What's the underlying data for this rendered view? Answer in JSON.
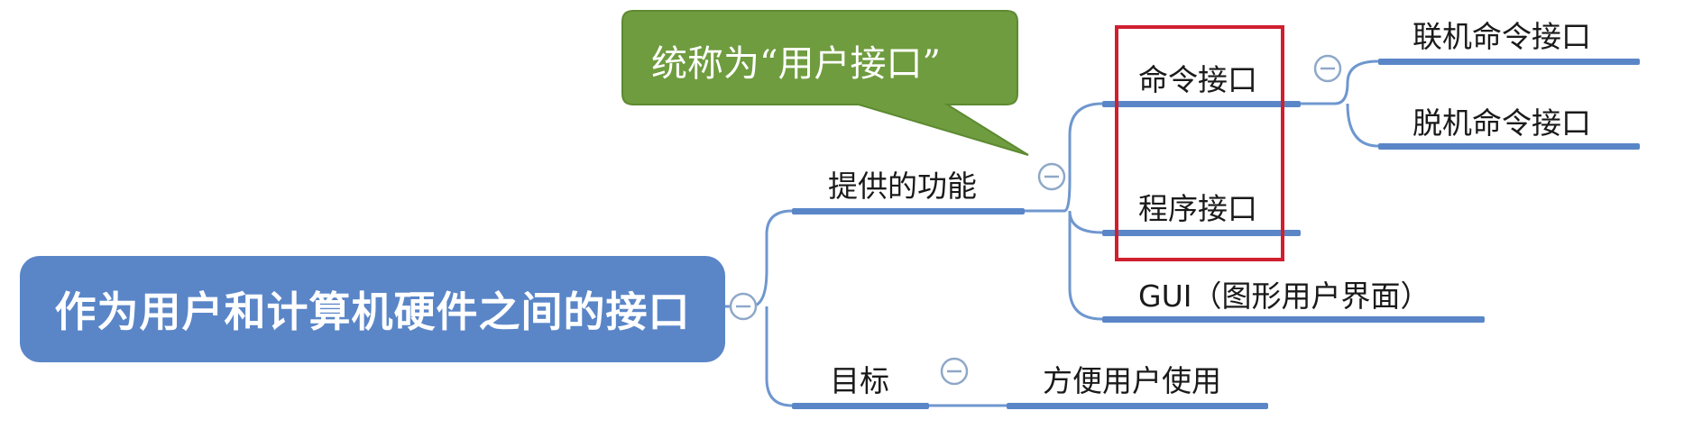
{
  "colors": {
    "root_fill": "#5a86c8",
    "branch_line": "#6f97cf",
    "underline": "#5a86c8",
    "callout_fill": "#6f9c3f",
    "highlight_border": "#d01f2f"
  },
  "root": {
    "label": "作为用户和计算机硬件之间的接口"
  },
  "callout": {
    "label": "统称为“用户接口”"
  },
  "branches": {
    "provide": {
      "label": "提供的功能"
    },
    "goal": {
      "label": "目标"
    }
  },
  "interfaces": {
    "command": {
      "label": "命令接口"
    },
    "program": {
      "label": "程序接口"
    },
    "gui": {
      "label": "GUI（图形用户界面）"
    }
  },
  "command_types": {
    "online": {
      "label": "联机命令接口"
    },
    "offline": {
      "label": "脱机命令接口"
    }
  },
  "goal_items": {
    "convenient": {
      "label": "方便用户使用"
    }
  },
  "icons": {
    "collapse": "minus-circle-icon"
  }
}
